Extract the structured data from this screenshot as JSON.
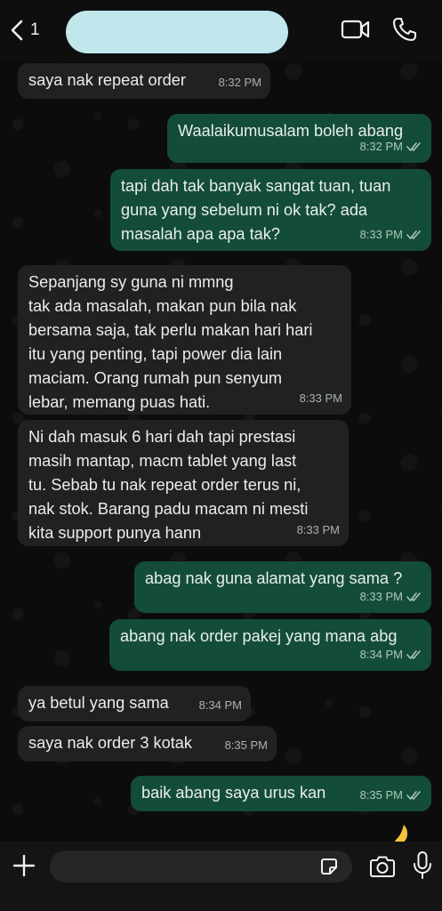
{
  "header": {
    "back_count": "1",
    "icons": [
      "chevron-left-icon",
      "video-call-icon",
      "phone-call-icon"
    ]
  },
  "messages": [
    {
      "dir": "in",
      "text": "saya nak repeat order",
      "time": "8:32 PM"
    },
    {
      "dir": "out",
      "text": "Waalaikumusalam boleh abang",
      "time": "8:32 PM"
    },
    {
      "dir": "out",
      "text": "tapi dah tak banyak sangat tuan, tuan\nguna yang sebelum ni ok tak? ada\nmasalah apa apa tak?",
      "time": "8:33 PM"
    },
    {
      "dir": "in",
      "text": "Sepanjang sy guna ni mmng\ntak ada masalah, makan pun bila nak\nbersama saja, tak perlu makan hari hari\nitu yang penting, tapi power dia lain\nmaciam. Orang rumah pun senyum\nlebar, memang puas hati.",
      "time": "8:33 PM"
    },
    {
      "dir": "in",
      "text": "Ni dah masuk 6 hari dah tapi prestasi\nmasih mantap, macm tablet yang last\ntu. Sebab tu nak repeat order terus ni,\nnak stok. Barang padu macam ni mesti\nkita support punya hann",
      "time": "8:33 PM"
    },
    {
      "dir": "out",
      "text": "abag nak guna alamat yang sama ?",
      "time": "8:33 PM"
    },
    {
      "dir": "out",
      "text": "abang nak order pakej yang mana abg",
      "time": "8:34 PM"
    },
    {
      "dir": "in",
      "text": "ya betul yang sama",
      "time": "8:34 PM"
    },
    {
      "dir": "in",
      "text": "saya nak order 3 kotak",
      "time": "8:35 PM"
    },
    {
      "dir": "out",
      "text": "baik abang saya urus kan",
      "time": "8:35 PM"
    }
  ],
  "footer": {
    "icons": [
      "plus-icon",
      "sticker-icon",
      "camera-icon",
      "microphone-icon"
    ]
  },
  "colors": {
    "incoming_bubble": "#212121",
    "outgoing_bubble": "#144d37",
    "contact_name_redaction": "#bfe7ec"
  }
}
